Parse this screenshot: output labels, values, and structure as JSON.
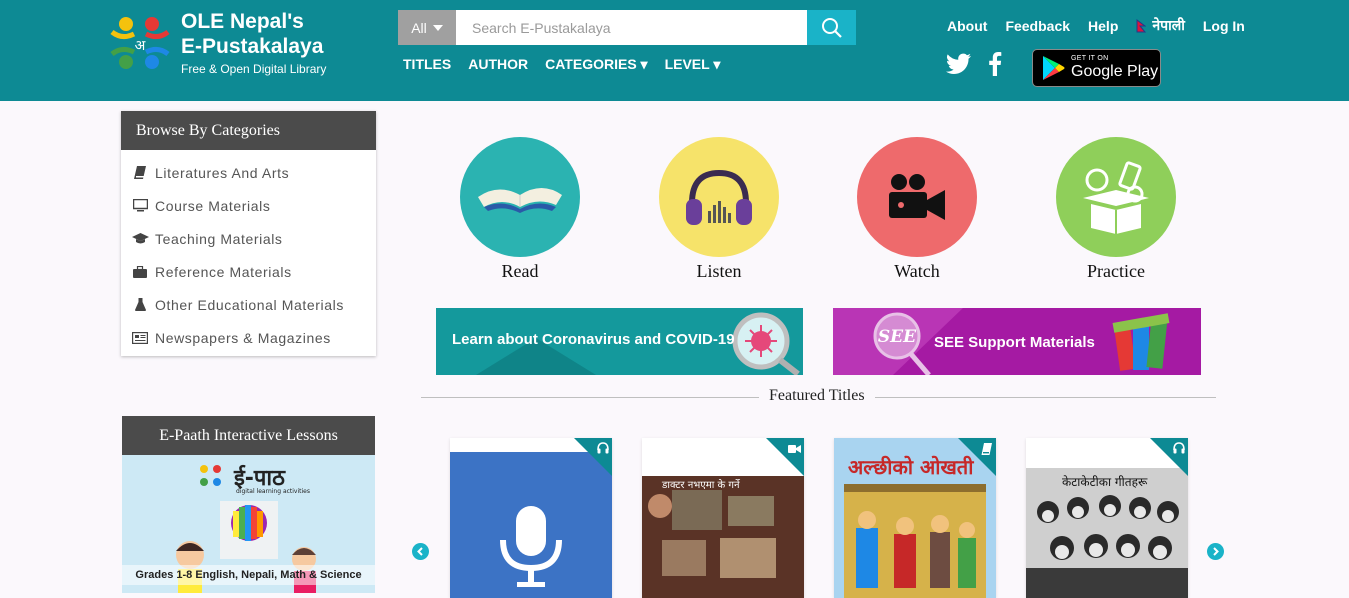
{
  "header": {
    "brand_line1": "OLE Nepal's",
    "brand_line2": "E-Pustakalaya",
    "tagline": "Free & Open Digital Library",
    "search": {
      "filter_label": "All",
      "placeholder": "Search E-Pustakalaya"
    },
    "nav": [
      "TITLES",
      "AUTHOR",
      "CATEGORIES ▾",
      "LEVEL ▾"
    ],
    "links": {
      "about": "About",
      "feedback": "Feedback",
      "help": "Help",
      "language": "नेपाली",
      "login": "Log In"
    },
    "play_badge": {
      "small": "GET IT ON",
      "big": "Google Play"
    },
    "social_icons": [
      "twitter-icon",
      "facebook-icon"
    ],
    "colors": {
      "header_bg": "#0d8a94",
      "accent": "#1ab3c8"
    }
  },
  "sidebar": {
    "categories_title": "Browse By Categories",
    "categories": [
      {
        "label": "Literatures And Arts",
        "icon": "book-icon"
      },
      {
        "label": "Course Materials",
        "icon": "monitor-icon"
      },
      {
        "label": "Teaching Materials",
        "icon": "graduation-cap-icon"
      },
      {
        "label": "Reference Materials",
        "icon": "briefcase-icon"
      },
      {
        "label": "Other Educational Materials",
        "icon": "flask-icon"
      },
      {
        "label": "Newspapers & Magazines",
        "icon": "newspaper-icon"
      }
    ],
    "epaath_title": "E-Paath Interactive Lessons",
    "epaath_logo": "ई-पाठ",
    "epaath_logo_sub": "digital learning activities",
    "epaath_caption": "Grades 1-8 English, Nepali, Math & Science"
  },
  "activities": [
    {
      "label": "Read",
      "color": "#2bb3b1"
    },
    {
      "label": "Listen",
      "color": "#f6e36a"
    },
    {
      "label": "Watch",
      "color": "#ee6a6c"
    },
    {
      "label": "Practice",
      "color": "#8fcf5a"
    }
  ],
  "banners": {
    "covid": "Learn about Coronavirus and COVID-19",
    "see": "SEE Support Materials",
    "see_badge": "SEE"
  },
  "featured": {
    "title": "Featured Titles",
    "items": [
      {
        "type": "audio-icon"
      },
      {
        "type": "video-icon",
        "cover_text": "डाक्टर नभएमा के गर्ने"
      },
      {
        "type": "book-icon",
        "cover_text": "अल्छीको ओखती"
      },
      {
        "type": "audio-icon",
        "cover_text": "केटाकेटीका गीतहरू"
      }
    ]
  }
}
